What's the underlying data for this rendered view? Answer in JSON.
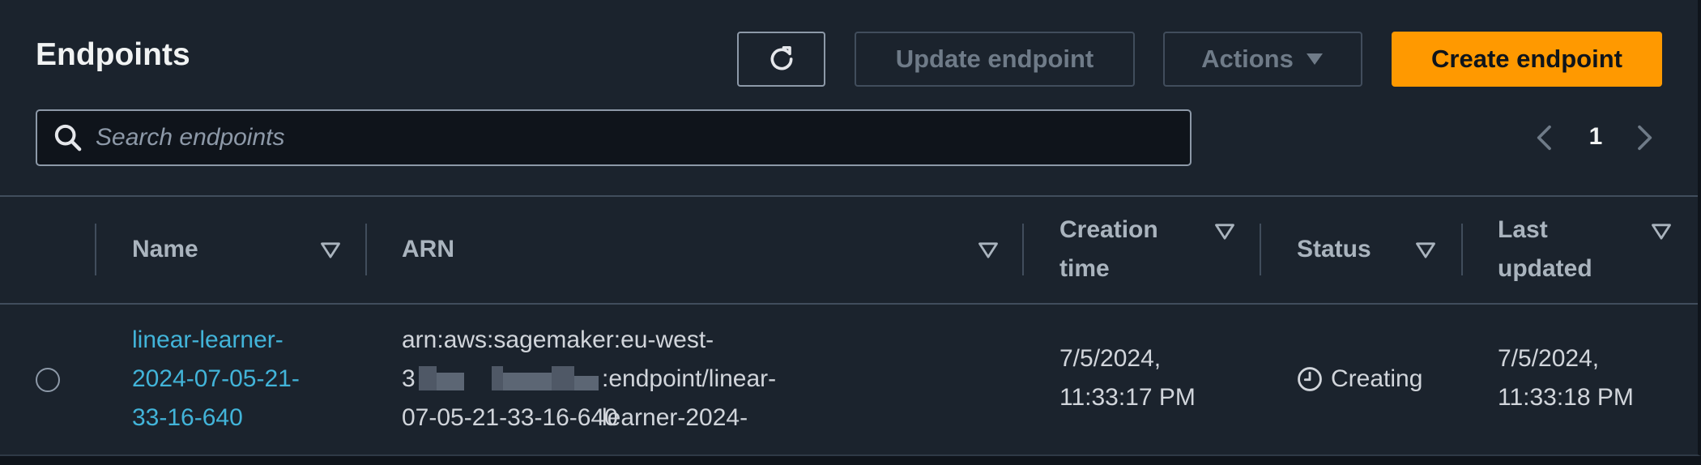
{
  "page": {
    "title": "Endpoints"
  },
  "toolbar": {
    "refresh_icon": "refresh-icon",
    "update_label": "Update endpoint",
    "actions_label": "Actions",
    "create_label": "Create endpoint",
    "accent_color": "#ff9900"
  },
  "search": {
    "placeholder": "Search endpoints",
    "value": ""
  },
  "pagination": {
    "current_page": "1"
  },
  "table": {
    "headers": {
      "name": "Name",
      "arn": "ARN",
      "creation_line1": "Creation",
      "creation_line2": "time",
      "status": "Status",
      "updated_line1": "Last",
      "updated_line2": "updated"
    },
    "rows": [
      {
        "name_lines": [
          "linear-learner-",
          "2024-07-05-21-",
          "33-16-640"
        ],
        "arn_lines": [
          "arn:aws:sagemaker:eu-west-",
          "3",
          ":endpoint/linear-learner-2024-",
          "07-05-21-33-16-640"
        ],
        "creation_lines": [
          "7/5/2024,",
          "11:33:17 PM"
        ],
        "status": "Creating",
        "status_icon": "clock-icon",
        "updated_lines": [
          "7/5/2024,",
          "11:33:18 PM"
        ]
      }
    ]
  }
}
